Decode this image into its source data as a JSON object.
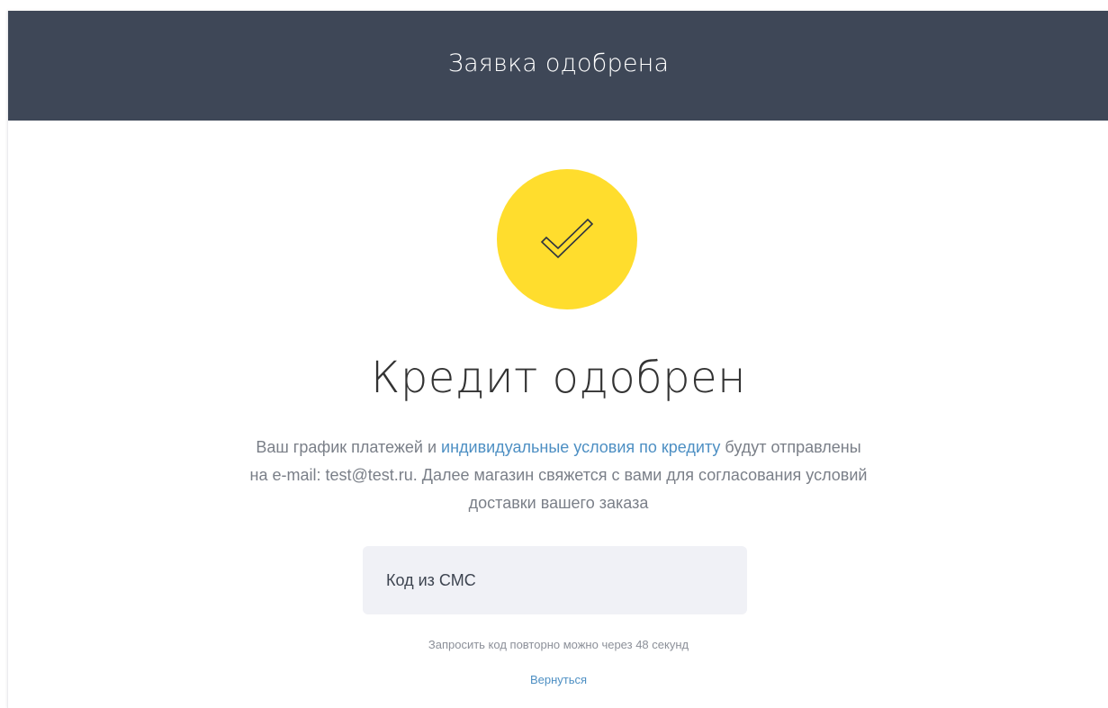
{
  "header": {
    "title": "Заявка одобрена"
  },
  "status_icon": {
    "name": "checkmark-icon",
    "background_color": "#ffdd2d"
  },
  "main": {
    "title": "Кредит одобрен",
    "description": {
      "line1_before": "Ваш график платежей и ",
      "line1_link": "индивидуальные условия по кредиту",
      "line1_after": " будут отправлены",
      "line2": "на e-mail: test@test.ru. Далее магазин свяжется с вами для согласования условий",
      "line3": "доставки вашего заказа"
    },
    "sms_input": {
      "placeholder": "Код из СМС",
      "value": ""
    },
    "resend_text": "Запросить код повторно можно через 48 секунд",
    "back_link": "Вернуться"
  },
  "colors": {
    "header_background": "#3e4757",
    "accent_yellow": "#ffdd2d",
    "link": "#4d8fc3",
    "input_background": "#f0f1f6"
  }
}
